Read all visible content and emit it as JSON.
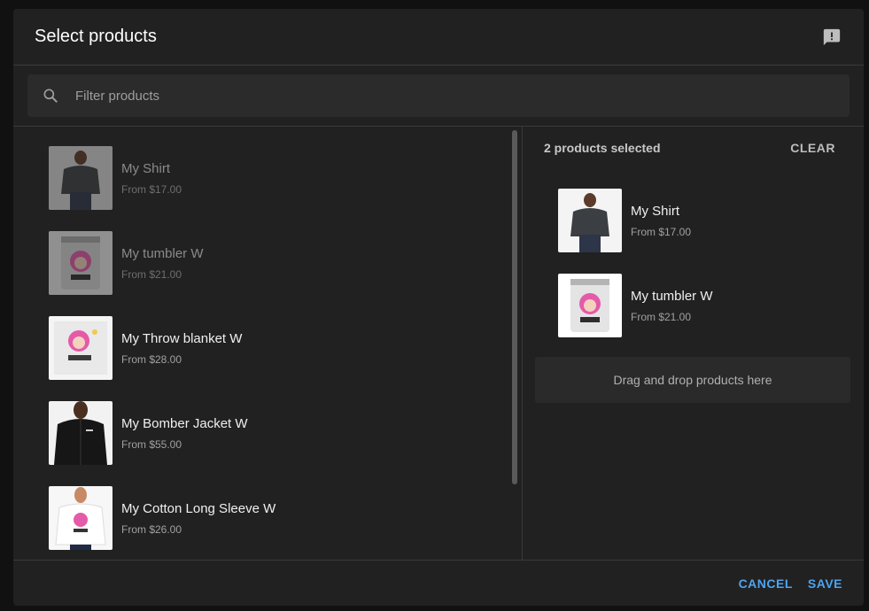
{
  "dialog": {
    "title": "Select products",
    "feedback_icon": "feedback-icon"
  },
  "search": {
    "placeholder": "Filter products",
    "value": "",
    "icon": "search-icon"
  },
  "product_list": [
    {
      "name": "My Shirt",
      "price": "From $17.00",
      "thumbnail": "dark-tshirt-model",
      "selected": true
    },
    {
      "name": "My tumbler W",
      "price": "From $21.00",
      "thumbnail": "tumbler-cartoon-girl",
      "selected": true
    },
    {
      "name": "My Throw blanket W",
      "price": "From $28.00",
      "thumbnail": "blanket-cartoon-girl",
      "selected": false
    },
    {
      "name": "My Bomber Jacket W",
      "price": "From $55.00",
      "thumbnail": "black-bomber-jacket-model",
      "selected": false
    },
    {
      "name": "My Cotton Long Sleeve W",
      "price": "From $26.00",
      "thumbnail": "white-long-sleeve-model",
      "selected": false
    }
  ],
  "selection": {
    "count_label": "2 products selected",
    "clear_label": "CLEAR",
    "items": [
      {
        "name": "My Shirt",
        "price": "From $17.00"
      },
      {
        "name": "My tumbler W",
        "price": "From $21.00"
      }
    ],
    "dropzone_label": "Drag and drop products here"
  },
  "footer": {
    "cancel_label": "CANCEL",
    "save_label": "SAVE"
  },
  "colors": {
    "accent": "#4ea4ef",
    "surface": "#212121",
    "field": "#2b2b2b"
  }
}
